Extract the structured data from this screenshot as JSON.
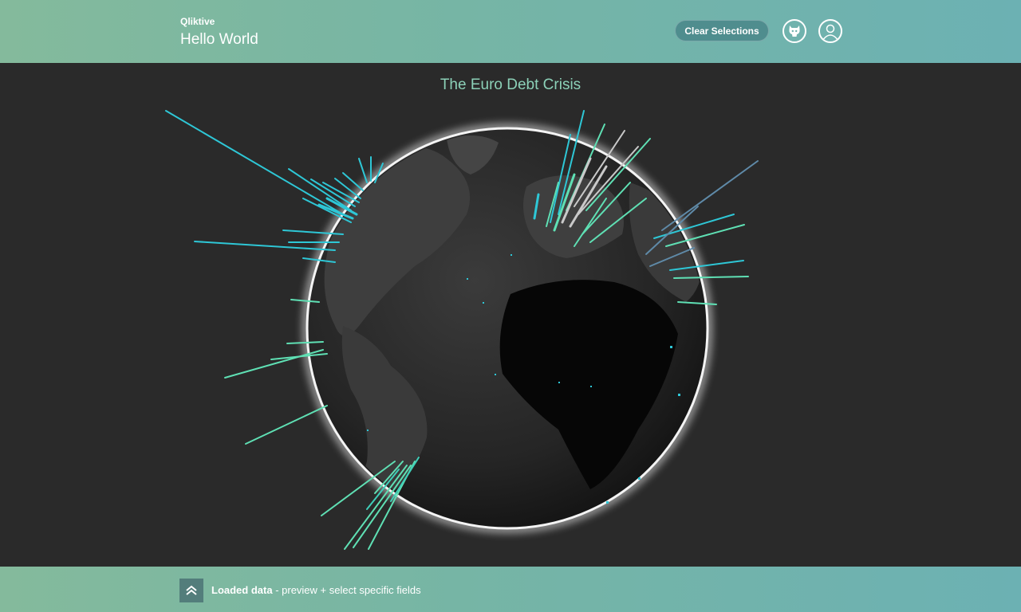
{
  "header": {
    "brand": "Qliktive",
    "title": "Hello World",
    "clear_button": "Clear Selections",
    "github_icon": "github-icon",
    "user_icon": "user-icon"
  },
  "main": {
    "title": "The Euro Debt Crisis",
    "visualization": "globe-spike-map"
  },
  "footer": {
    "toggle_icon": "double-chevron-up-icon",
    "label_bold": "Loaded data",
    "label_rest": " - preview + select specific fields"
  },
  "colors": {
    "header_left": "#84ba9c",
    "header_right": "#6cb1b3",
    "background": "#2a2a2a",
    "title": "#8cd1b8",
    "spike_cyan": "#2ec7d6",
    "spike_mint": "#5fe0b4",
    "spike_grey": "#c9c9c9",
    "spike_steel": "#5f8aa8"
  }
}
